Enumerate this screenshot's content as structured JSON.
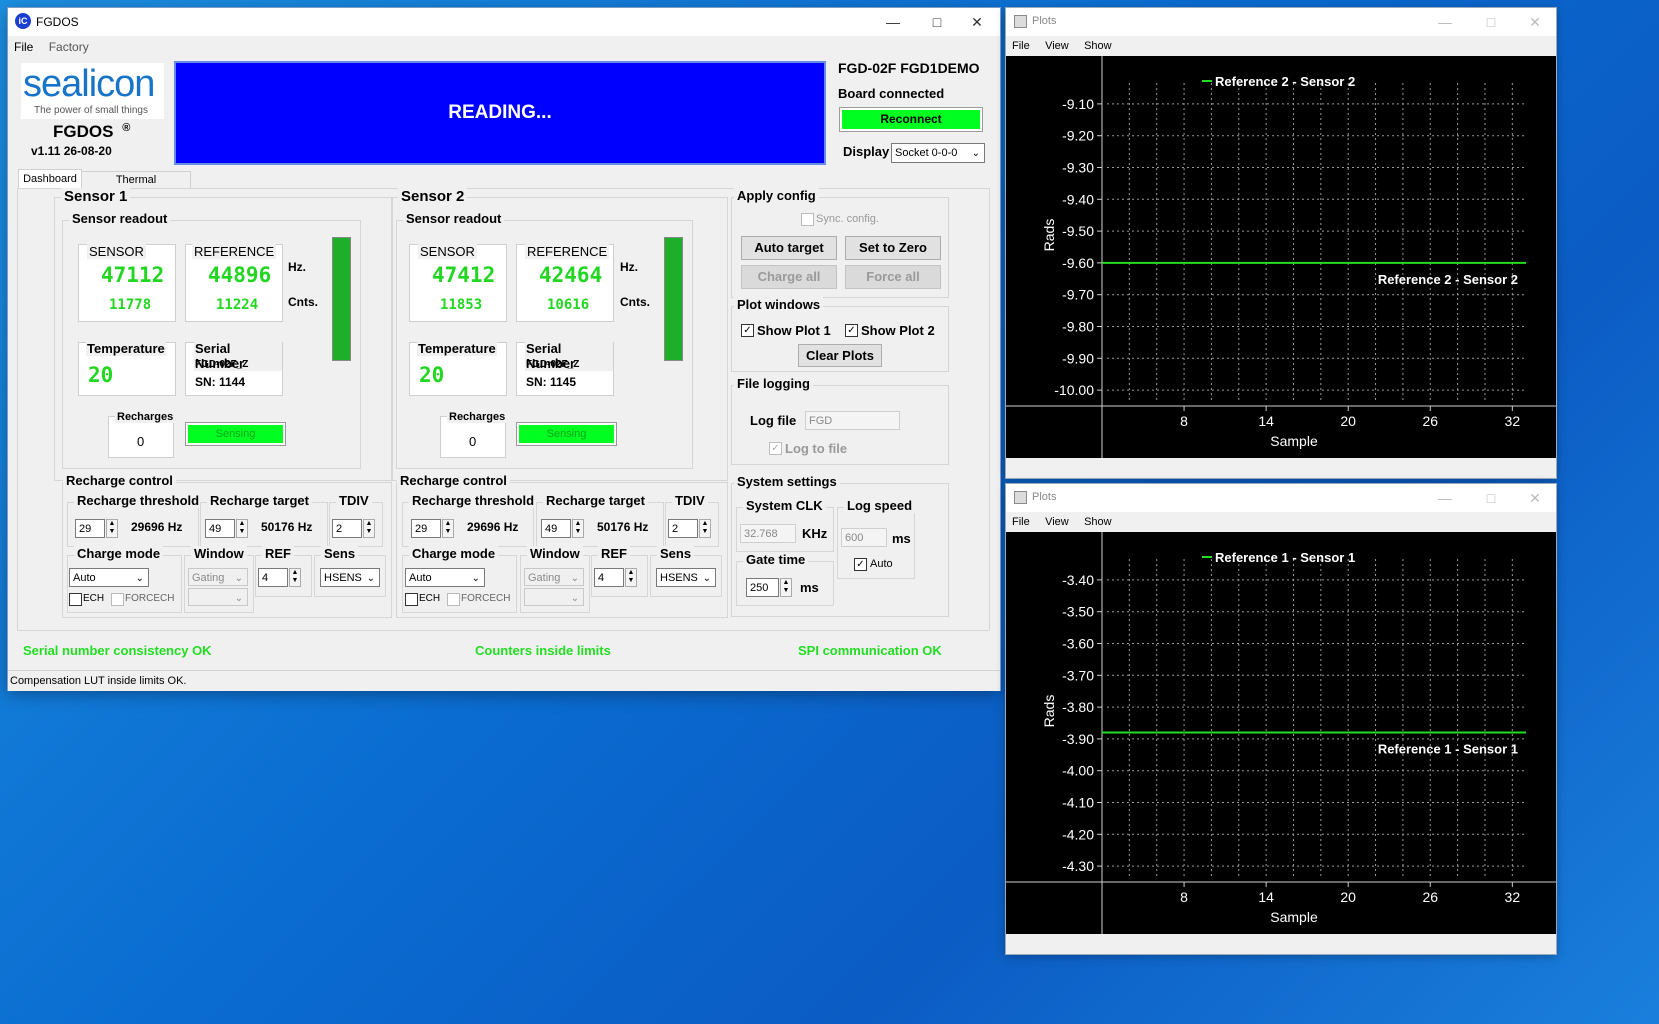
{
  "main": {
    "title": "FGDOS",
    "menu": [
      "File",
      "Factory"
    ],
    "logo": {
      "brand": "sealicon",
      "tagline": "The power of small things"
    },
    "product": "FGDOS",
    "reg": "®",
    "version": "v1.11 26-08-20",
    "status_display": "READING...",
    "device_name": "FGD-02F FGD1DEMO",
    "board_status": "Board connected",
    "reconnect_label": "Reconnect",
    "display_label": "Display",
    "display_value": "Socket 0-0-0",
    "tabs": [
      "Dashboard",
      "Thermal compensation"
    ],
    "sensors": [
      {
        "title": "Sensor 1",
        "readout_title": "Sensor readout",
        "sensor_label": "SENSOR",
        "reference_label": "REFERENCE",
        "sensor_hz": "47112",
        "sensor_cnts": "11778",
        "ref_hz": "44896",
        "ref_cnts": "11224",
        "hz_unit": "Hz.",
        "cnts_unit": "Cnts.",
        "temp_label": "Temperature",
        "temp": "20",
        "serial_label": "Serial Number",
        "serial_model": "FGD-02F_Z",
        "serial_sn": "SN: 1144",
        "recharges_label": "Recharges",
        "recharges": "0",
        "state": "Sensing",
        "recharge_title": "Recharge control",
        "threshold_label": "Recharge threshold",
        "threshold_value": "29",
        "threshold_hz": "29696 Hz",
        "target_label": "Recharge target",
        "target_value": "49",
        "target_hz": "50176 Hz",
        "tdiv_label": "TDIV",
        "tdiv_value": "2",
        "charge_mode_label": "Charge mode",
        "charge_mode": "Auto",
        "ech_label": "ECH",
        "forcech_label": "FORCECH",
        "window_label": "Window",
        "window_value": "Gating",
        "ref_label": "REF",
        "ref_value": "4",
        "sens_label": "Sens",
        "sens_value": "HSENS"
      },
      {
        "title": "Sensor 2",
        "readout_title": "Sensor readout",
        "sensor_label": "SENSOR",
        "reference_label": "REFERENCE",
        "sensor_hz": "47412",
        "sensor_cnts": "11853",
        "ref_hz": "42464",
        "ref_cnts": "10616",
        "hz_unit": "Hz.",
        "cnts_unit": "Cnts.",
        "temp_label": "Temperature",
        "temp": "20",
        "serial_label": "Serial Number",
        "serial_model": "FGD-02F_Z",
        "serial_sn": "SN: 1145",
        "recharges_label": "Recharges",
        "recharges": "0",
        "state": "Sensing",
        "recharge_title": "Recharge control",
        "threshold_label": "Recharge threshold",
        "threshold_value": "29",
        "threshold_hz": "29696 Hz",
        "target_label": "Recharge target",
        "target_value": "49",
        "target_hz": "50176 Hz",
        "tdiv_label": "TDIV",
        "tdiv_value": "2",
        "charge_mode_label": "Charge mode",
        "charge_mode": "Auto",
        "ech_label": "ECH",
        "forcech_label": "FORCECH",
        "window_label": "Window",
        "window_value": "Gating",
        "ref_label": "REF",
        "ref_value": "4",
        "sens_label": "Sens",
        "sens_value": "HSENS"
      }
    ],
    "apply": {
      "title": "Apply config",
      "sync_label": "Sync. config.",
      "auto_target": "Auto target",
      "set_zero": "Set to Zero",
      "charge_all": "Charge all",
      "force_all": "Force all"
    },
    "plotwins": {
      "title": "Plot windows",
      "show1": "Show Plot 1",
      "show2": "Show Plot 2",
      "clear": "Clear Plots"
    },
    "logging": {
      "title": "File logging",
      "log_file_label": "Log file",
      "log_file_value": "FGD",
      "log_to_file": "Log to file"
    },
    "system": {
      "title": "System settings",
      "clk_label": "System CLK",
      "clk_value": "32.768",
      "clk_unit": "KHz",
      "log_speed_label": "Log speed",
      "log_speed_value": "600",
      "log_speed_unit": "ms",
      "gate_label": "Gate time",
      "gate_value": "250",
      "gate_unit": "ms",
      "auto_label": "Auto"
    },
    "status_lines": [
      "Serial number consistency OK",
      "Counters inside limits",
      "SPI communication OK"
    ],
    "status_bar": "Compensation LUT inside limits OK.",
    "colors": {
      "status_blue": "#0000ff",
      "ok_green": "#22dd22",
      "bar_green": "#1fae2a"
    }
  },
  "plots": [
    {
      "title": "Plots",
      "menu": [
        "File",
        "View",
        "Show"
      ],
      "legend_top": "Reference 2 - Sensor 2",
      "curve_label": "Reference 2 - Sensor 2",
      "ylabel": "Rads",
      "xlabel": "Sample",
      "yticks": [
        "-9.10",
        "-9.20",
        "-9.30",
        "-9.40",
        "-9.50",
        "-9.60",
        "-9.70",
        "-9.80",
        "-9.90",
        "-10.00"
      ],
      "xticks": [
        "8",
        "14",
        "20",
        "26",
        "32"
      ]
    },
    {
      "title": "Plots",
      "menu": [
        "File",
        "View",
        "Show"
      ],
      "legend_top": "Reference 1 - Sensor 1",
      "curve_label": "Reference 1 - Sensor 1",
      "ylabel": "Rads",
      "xlabel": "Sample",
      "yticks": [
        "-3.40",
        "-3.50",
        "-3.60",
        "-3.70",
        "-3.80",
        "-3.90",
        "-4.00",
        "-4.10",
        "-4.20",
        "-4.30"
      ],
      "xticks": [
        "8",
        "14",
        "20",
        "26",
        "32"
      ]
    }
  ],
  "chart_data": [
    {
      "type": "line",
      "title": "",
      "xlabel": "Sample",
      "ylabel": "Rads",
      "ylim": [
        -10.05,
        -9.05
      ],
      "xlim": [
        2,
        33
      ],
      "grid": true,
      "series": [
        {
          "name": "Reference 2 - Sensor 2",
          "color": "#22dd22",
          "x": [
            2,
            8,
            14,
            20,
            26,
            32,
            33
          ],
          "y": [
            -9.6,
            -9.6,
            -9.6,
            -9.6,
            -9.6,
            -9.6,
            -9.6
          ]
        }
      ]
    },
    {
      "type": "line",
      "title": "",
      "xlabel": "Sample",
      "ylabel": "Rads",
      "ylim": [
        -4.35,
        -3.35
      ],
      "xlim": [
        2,
        33
      ],
      "grid": true,
      "series": [
        {
          "name": "Reference 1 - Sensor 1",
          "color": "#22dd22",
          "x": [
            2,
            8,
            14,
            20,
            26,
            32,
            33
          ],
          "y": [
            -3.88,
            -3.88,
            -3.88,
            -3.88,
            -3.88,
            -3.88,
            -3.88
          ]
        }
      ]
    }
  ]
}
